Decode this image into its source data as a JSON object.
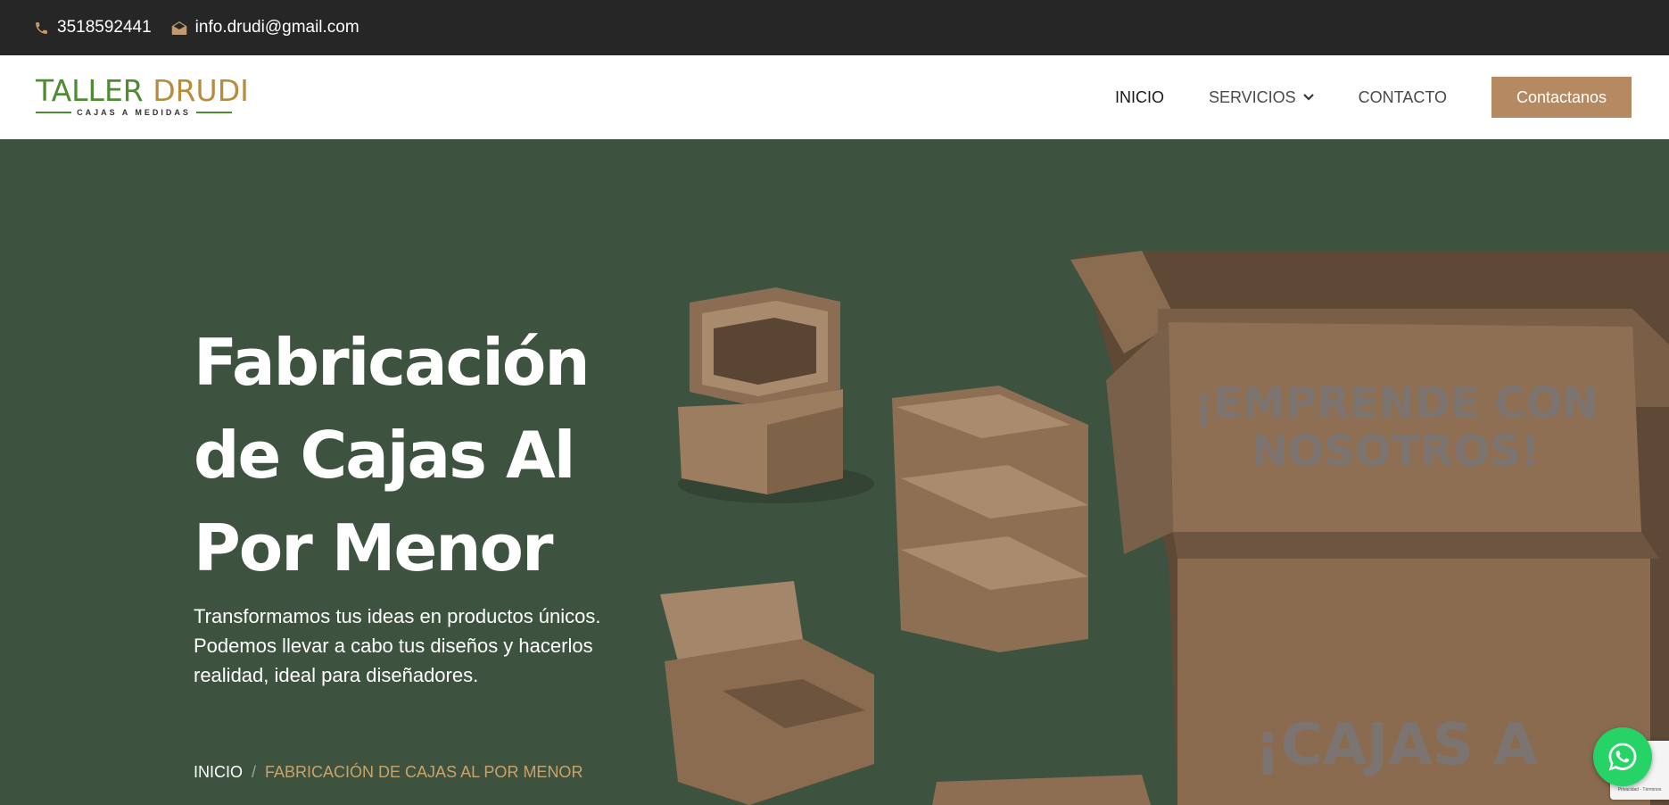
{
  "topbar": {
    "phone": "3518592441",
    "email": "info.drudi@gmail.com",
    "phone_icon": "phone-icon",
    "email_icon": "envelope-icon"
  },
  "logo": {
    "word1": "TALLER ",
    "word2": "DRUDI",
    "tagline": "CAJAS A MEDIDAS"
  },
  "nav": {
    "items": [
      {
        "label": "INICIO"
      },
      {
        "label": "SERVICIOS"
      },
      {
        "label": "CONTACTO"
      }
    ],
    "cta": "Contactanos"
  },
  "hero": {
    "title": "Fabricación de Cajas Al Por Menor",
    "text": "Transformamos tus ideas en productos únicos. Podemos llevar a cabo tus diseños y hacerlos realidad, ideal para diseñadores.",
    "box_text1": "¡EMPRENDE CON",
    "box_text2": "NOSOTROS!",
    "box_text3": "¡CAJAS A"
  },
  "breadcrumb": {
    "home": "INICIO",
    "separator": "/",
    "current": "FABRICACIÓN DE CAJAS AL POR MENOR"
  },
  "recaptcha": {
    "text": "Privacidad - Términos"
  },
  "colors": {
    "topbar_bg": "#262626",
    "hero_bg": "#3e5240",
    "cta_bg": "#b58a62",
    "accent_gold": "#c9a46a",
    "logo_green": "#4e8c32",
    "whatsapp": "#25d366"
  }
}
